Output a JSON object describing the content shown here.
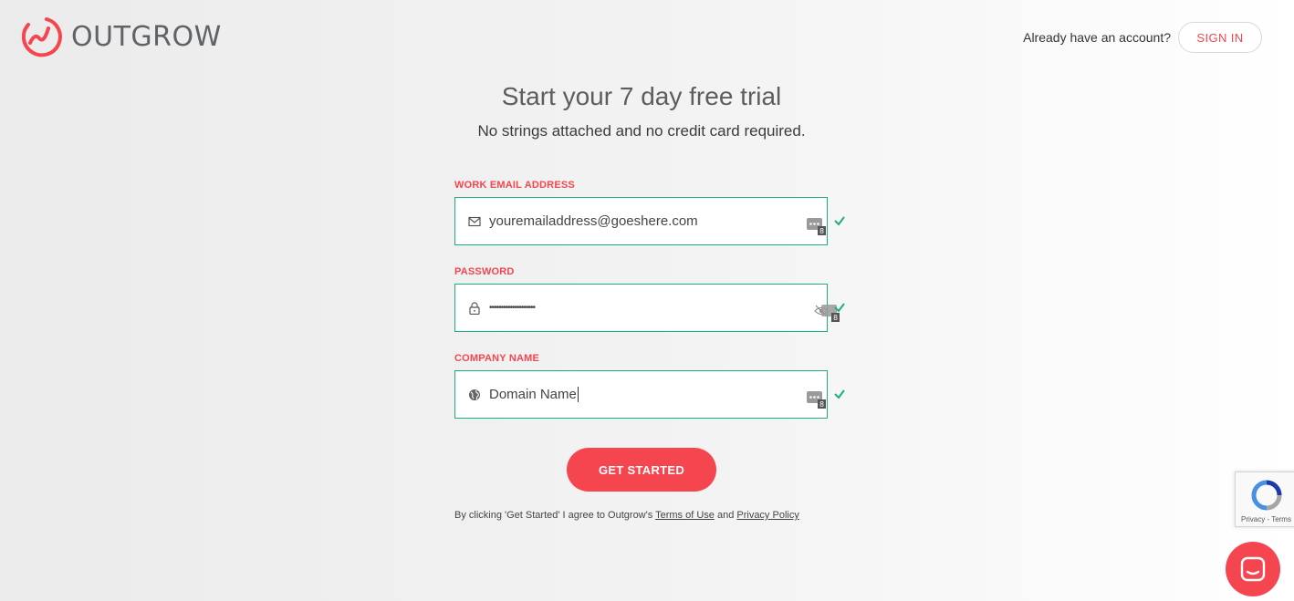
{
  "brand": {
    "name": "OUTGROW",
    "accent": "#f5454f",
    "success": "#1aae84"
  },
  "header": {
    "account_question": "Already have an account?",
    "signin_label": "SIGN IN"
  },
  "hero": {
    "title": "Start your 7 day free trial",
    "subtitle": "No strings attached and no credit card required."
  },
  "form": {
    "email": {
      "label": "WORK EMAIL ADDRESS",
      "value": "youremailaddress@goeshere.com",
      "icon": "mail-icon",
      "valid": true
    },
    "password": {
      "label": "PASSWORD",
      "value": "••••••••••••••••••••",
      "icon": "lock-icon",
      "valid": true
    },
    "company": {
      "label": "COMPANY NAME",
      "value": "Domain Name",
      "icon": "globe-icon",
      "valid": true
    },
    "submit_label": "GET STARTED"
  },
  "terms": {
    "prefix": "By clicking 'Get Started' I agree to Outgrow's",
    "terms_link": "Terms of Use",
    "and": "and",
    "privacy_link": "Privacy Policy"
  },
  "recaptcha": {
    "links": "Privacy - Terms"
  }
}
